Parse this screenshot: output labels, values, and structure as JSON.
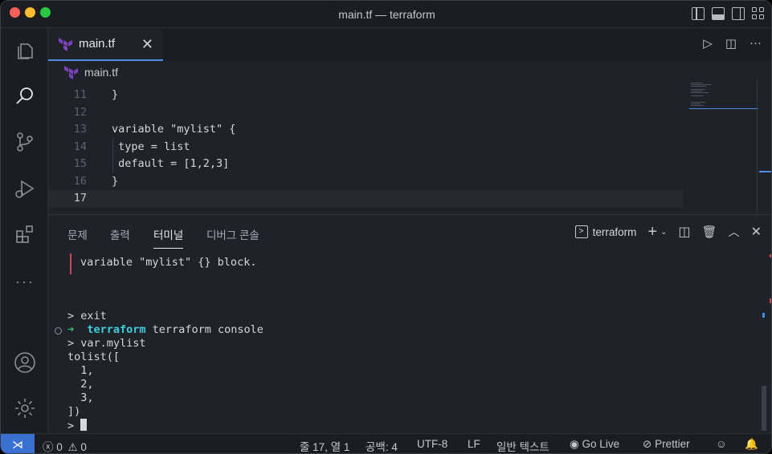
{
  "window": {
    "title": "main.tf — terraform"
  },
  "editor": {
    "tab_label": "main.tf",
    "tab_close": "✕",
    "breadcrumb": "main.tf",
    "lines": [
      {
        "num": "11",
        "text": "}"
      },
      {
        "num": "12",
        "text": ""
      },
      {
        "num": "13",
        "text": "variable \"mylist\" {"
      },
      {
        "num": "14",
        "text": " type = list"
      },
      {
        "num": "15",
        "text": " default = [1,2,3]"
      },
      {
        "num": "16",
        "text": "}"
      },
      {
        "num": "17",
        "text": ""
      }
    ]
  },
  "panel": {
    "tabs": [
      "문제",
      "출력",
      "터미널",
      "디버그 콘솔"
    ],
    "active_tab": "터미널",
    "terminal_name": "terraform",
    "terminal_lines": {
      "err": "variable \"mylist\" {} block.",
      "exit": "> exit",
      "prompt_dir": "terraform",
      "prompt_cmd": " terraform console",
      "cmd": "> var.mylist",
      "o1": "tolist([",
      "o2": "  1,",
      "o3": "  2,",
      "o4": "  3,",
      "o5": "])",
      "o6": "> "
    }
  },
  "statusbar": {
    "errors": "0",
    "warnings": "0",
    "position": "줄 17, 열 1",
    "spaces": "공백: 4",
    "encoding": "UTF-8",
    "eol": "LF",
    "language": "일반 텍스트",
    "golive": "Go Live",
    "prettier": "Prettier"
  },
  "colors": {
    "accent": "#4f8be0",
    "remote": "#3a70d0",
    "terraform": "#7b42bc"
  }
}
